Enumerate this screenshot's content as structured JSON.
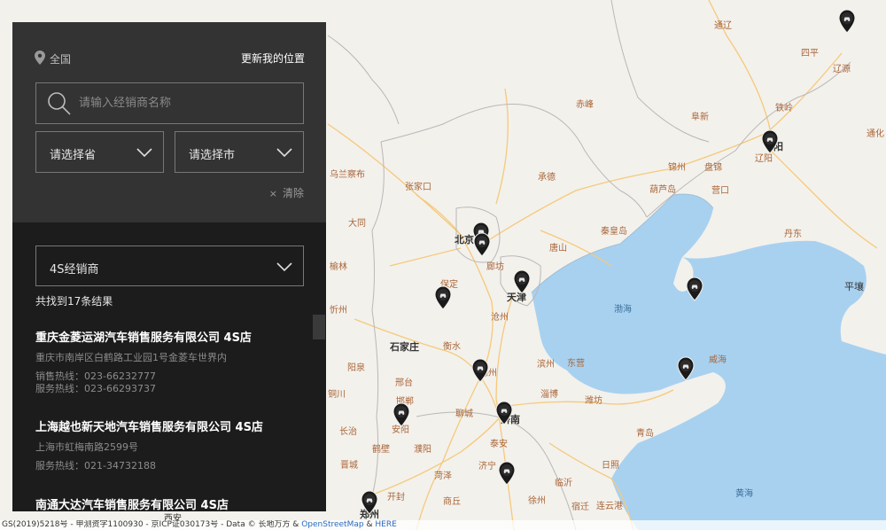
{
  "panel": {
    "location_label": "全国",
    "update_location": "更新我的位置",
    "search_placeholder": "请输入经销商名称",
    "province_placeholder": "请选择省",
    "city_placeholder": "请选择市",
    "clear_label": "清除",
    "clear_icon": "×",
    "dealer_type": "4S经销商",
    "result_count": "共找到17条结果",
    "dealers": [
      {
        "name": "重庆金菱运湖汽车销售服务有限公司 4S店",
        "address": "重庆市南岸区白鹤路工业园1号金菱车世界内",
        "sales_phone": "销售热线：023-66232777",
        "service_phone": "服务热线：023-66293737"
      },
      {
        "name": "上海越也新天地汽车销售服务有限公司 4S店",
        "address": "上海市虹梅南路2599号",
        "service_phone": "服务热线：021-34732188"
      },
      {
        "name": "南通大达汽车销售服务有限公司 4S店"
      }
    ]
  },
  "map": {
    "cities": {
      "beijing": "北京",
      "tianjin": "天津",
      "shijiazhuang": "石家庄",
      "jinan": "济南",
      "zhengzhou": "郑州",
      "xian": "西安",
      "shenyang": "阳",
      "pingrang": "平壤",
      "bohai": "渤海",
      "huanghai": "黄海",
      "zhangjiakou": "张家口",
      "chengde": "承德",
      "chifeng": "赤峰",
      "fuxin": "阜新",
      "tieling": "铁岭",
      "tongliao": "通辽",
      "siping": "四平",
      "liaoyuan": "辽源",
      "tonghua": "通化",
      "jinzhou": "锦州",
      "panjin": "盘锦",
      "liaoyang": "辽阳",
      "huludao": "葫芦岛",
      "yingkou": "营口",
      "dandong": "丹东",
      "qinhuangdao": "秦皇岛",
      "tangshan": "唐山",
      "langfang": "廊坊",
      "cangzhou": "沧州",
      "baoding": "保定",
      "hengshui": "衡水",
      "xingtai": "邢台",
      "handan": "邯郸",
      "dezhou": "德州",
      "binzhou": "滨州",
      "dongying": "东营",
      "weifang": "潍坊",
      "zibo": "淄博",
      "weihai": "威海",
      "qingdao": "青岛",
      "rizhao": "日照",
      "linyi": "临沂",
      "liaocheng": "聊城",
      "jining": "济宁",
      "taian": "泰安",
      "heze": "菏泽",
      "anyang": "安阳",
      "hebi": "鹤壁",
      "puyang": "濮阳",
      "kaifeng": "开封",
      "lianyungang": "连云港",
      "wulanchabu": "乌兰察布",
      "datong": "大同",
      "yangquan": "阳泉",
      "xinzhou": "忻州",
      "changzhi": "长治",
      "jincheng": "晋城",
      "shangqiu": "商丘",
      "tongchuan": "铜川",
      "xuzhou": "徐州",
      "suqian": "宿迁",
      "yulin": "榆林"
    },
    "attribution": "GS(2019)5218号 - 甲测资字1100930 - 京ICP证030173号 - Data © 长地万方 &",
    "attribution_osm": "OpenStreetMap",
    "attribution_amp": "&",
    "attribution_here": "HERE",
    "colors": {
      "land": "#f3f1ec",
      "sea": "#a8d1f0",
      "road": "#f5c97b",
      "panel": "#1c1c1c"
    },
    "pin_icon": "car-dealer-pin-icon"
  }
}
